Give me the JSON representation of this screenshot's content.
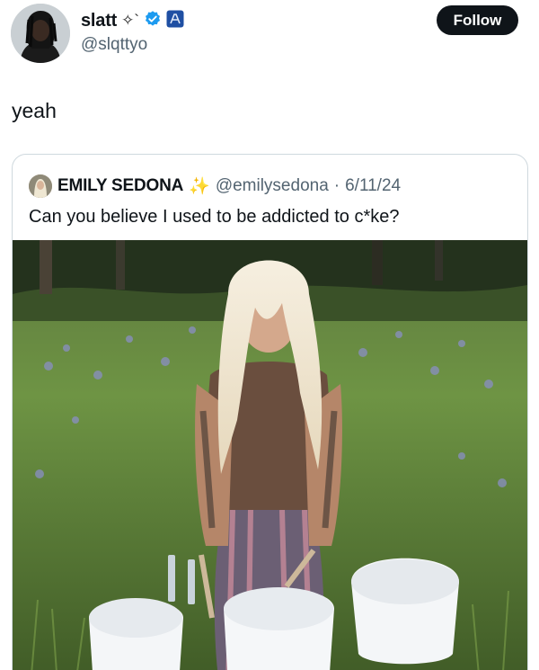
{
  "author": {
    "display_name": "slatt",
    "name_emoji": "✧`",
    "handle": "@slqttyo",
    "verified": true,
    "affiliate_badge_icon": "affiliate-badge-icon",
    "verified_color": "#1d9bf0"
  },
  "follow": {
    "label": "Follow"
  },
  "tweet": {
    "text": "yeah"
  },
  "quote": {
    "display_name": "EMILY SEDONA",
    "sparkle": "✨",
    "handle": "@emilysedona",
    "separator": "·",
    "date": "6/11/24",
    "text": "Can you believe I used to be addicted to c*ke?"
  },
  "colors": {
    "text": "#0f1419",
    "secondary": "#536471",
    "border": "#cfd9de",
    "button_bg": "#0f1419"
  }
}
